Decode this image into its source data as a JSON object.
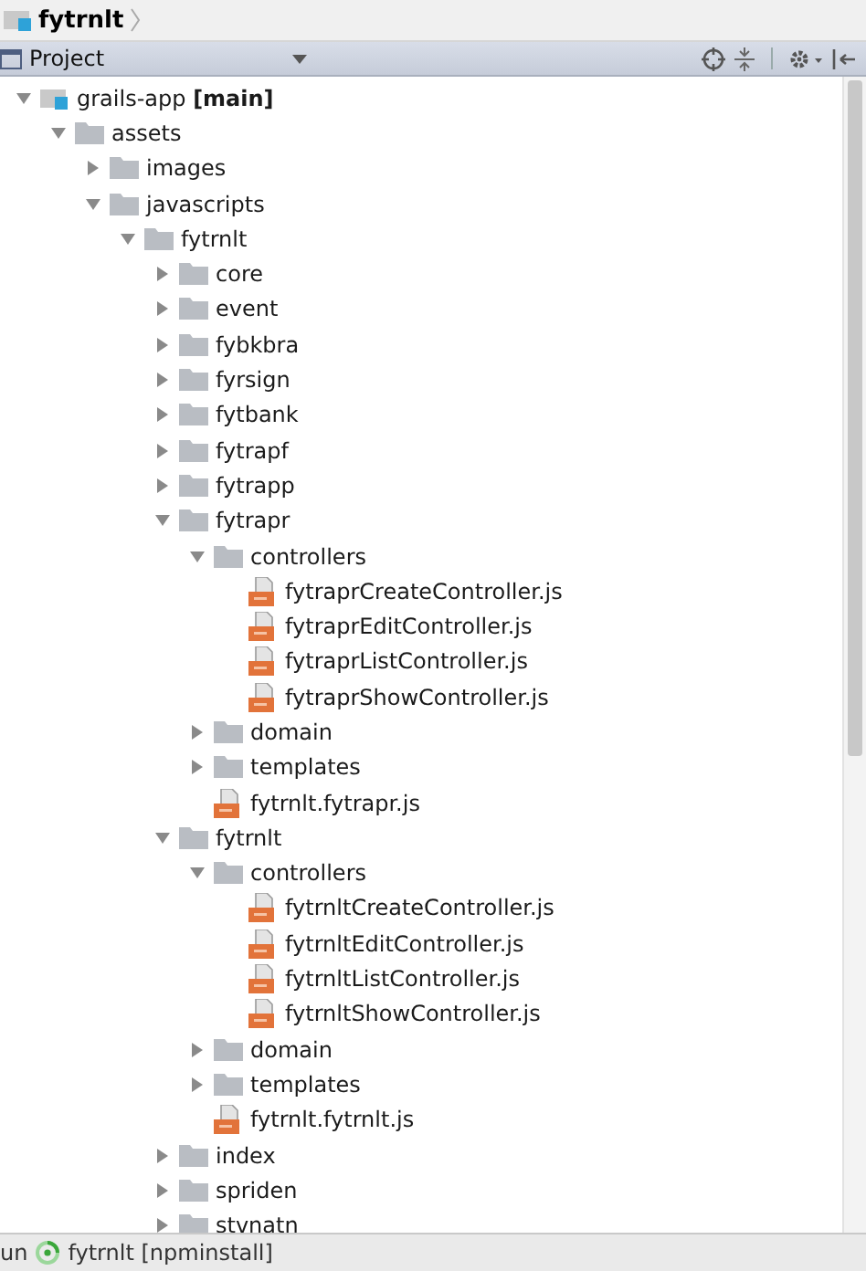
{
  "breadcrumb": {
    "label": "fytrnlt"
  },
  "panel": {
    "title": "Project"
  },
  "tree": [
    {
      "kind": "module",
      "label": "grails-app **[main]**",
      "expanded": true,
      "children": [
        {
          "kind": "folder",
          "label": "assets",
          "expanded": true,
          "children": [
            {
              "kind": "folder",
              "label": "images",
              "expanded": false
            },
            {
              "kind": "folder",
              "label": "javascripts",
              "expanded": true,
              "children": [
                {
                  "kind": "folder",
                  "label": "fytrnlt",
                  "expanded": true,
                  "children": [
                    {
                      "kind": "folder",
                      "label": "core",
                      "expanded": false
                    },
                    {
                      "kind": "folder",
                      "label": "event",
                      "expanded": false
                    },
                    {
                      "kind": "folder",
                      "label": "fybkbra",
                      "expanded": false
                    },
                    {
                      "kind": "folder",
                      "label": "fyrsign",
                      "expanded": false
                    },
                    {
                      "kind": "folder",
                      "label": "fytbank",
                      "expanded": false
                    },
                    {
                      "kind": "folder",
                      "label": "fytrapf",
                      "expanded": false
                    },
                    {
                      "kind": "folder",
                      "label": "fytrapp",
                      "expanded": false
                    },
                    {
                      "kind": "folder",
                      "label": "fytrapr",
                      "expanded": true,
                      "children": [
                        {
                          "kind": "folder",
                          "label": "controllers",
                          "expanded": true,
                          "children": [
                            {
                              "kind": "file",
                              "label": "fytraprCreateController.js"
                            },
                            {
                              "kind": "file",
                              "label": "fytraprEditController.js"
                            },
                            {
                              "kind": "file",
                              "label": "fytraprListController.js"
                            },
                            {
                              "kind": "file",
                              "label": "fytraprShowController.js"
                            }
                          ]
                        },
                        {
                          "kind": "folder",
                          "label": "domain",
                          "expanded": false
                        },
                        {
                          "kind": "folder",
                          "label": "templates",
                          "expanded": false
                        },
                        {
                          "kind": "file",
                          "label": "fytrnlt.fytrapr.js"
                        }
                      ]
                    },
                    {
                      "kind": "folder",
                      "label": "fytrnlt",
                      "expanded": true,
                      "children": [
                        {
                          "kind": "folder",
                          "label": "controllers",
                          "expanded": true,
                          "children": [
                            {
                              "kind": "file",
                              "label": "fytrnltCreateController.js"
                            },
                            {
                              "kind": "file",
                              "label": "fytrnltEditController.js"
                            },
                            {
                              "kind": "file",
                              "label": "fytrnltListController.js"
                            },
                            {
                              "kind": "file",
                              "label": "fytrnltShowController.js"
                            }
                          ]
                        },
                        {
                          "kind": "folder",
                          "label": "domain",
                          "expanded": false
                        },
                        {
                          "kind": "folder",
                          "label": "templates",
                          "expanded": false
                        },
                        {
                          "kind": "file",
                          "label": "fytrnlt.fytrnlt.js"
                        }
                      ]
                    },
                    {
                      "kind": "folder",
                      "label": "index",
                      "expanded": false
                    },
                    {
                      "kind": "folder",
                      "label": "spriden",
                      "expanded": false
                    },
                    {
                      "kind": "folder",
                      "label": "stvnatn",
                      "expanded": false
                    }
                  ]
                }
              ]
            }
          ]
        }
      ]
    }
  ],
  "status_bar": {
    "prefix": "un",
    "label": "fytrnlt [npminstall]"
  }
}
